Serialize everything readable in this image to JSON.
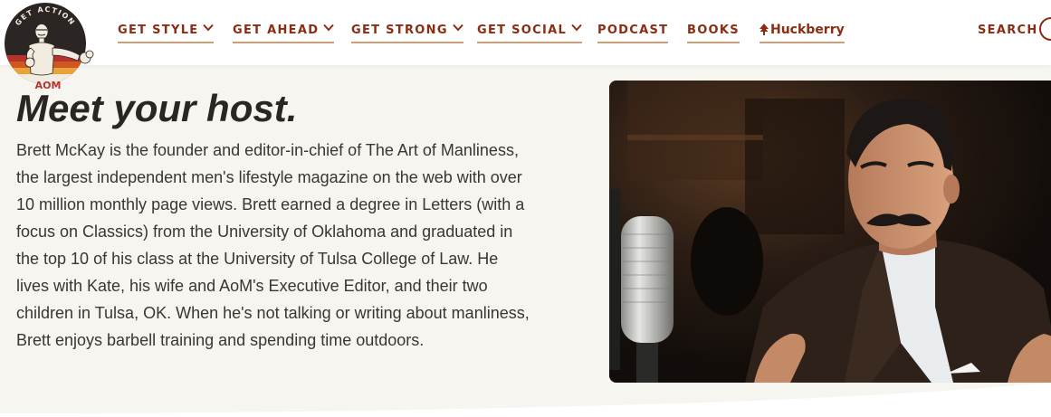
{
  "logo": {
    "ring_text": "GET ACTION",
    "badge_text": "AOM",
    "colors": {
      "ring": "#2b2523",
      "stripe_orange": "#d0581f",
      "stripe_gold": "#e8a33c",
      "stripe_red": "#b7322a"
    }
  },
  "nav": {
    "items": [
      {
        "label": "GET STYLE",
        "has_dropdown": true
      },
      {
        "label": "GET AHEAD",
        "has_dropdown": true
      },
      {
        "label": "GET STRONG",
        "has_dropdown": true
      },
      {
        "label": "GET SOCIAL",
        "has_dropdown": true
      },
      {
        "label": "PODCAST",
        "has_dropdown": false
      },
      {
        "label": "BOOKS",
        "has_dropdown": false
      },
      {
        "label": "Huckberry",
        "has_dropdown": false,
        "icon": "tree-icon"
      }
    ],
    "search_label": "SEARCH",
    "accent_color": "#8b2c14"
  },
  "main": {
    "title": "Meet your host.",
    "bio": "Brett McKay is the founder and editor-in-chief of The Art of Manliness, the largest independent men's lifestyle magazine on the web with over 10 million monthly page views. Brett earned a degree in Letters (with a focus on Classics) from the University of Oklahoma and graduated in the top 10 of his class at the University of Tulsa College of Law. He lives with Kate, his wife and AoM's Executive Editor, and their two children in Tulsa, OK. When he's not talking or writing about manliness, Brett enjoys barbell training and spending time outdoors."
  },
  "photo": {
    "subject": "host-photo"
  },
  "colors": {
    "background": "#f6f5f0",
    "text": "#3a3632",
    "heading": "#2a2623"
  }
}
